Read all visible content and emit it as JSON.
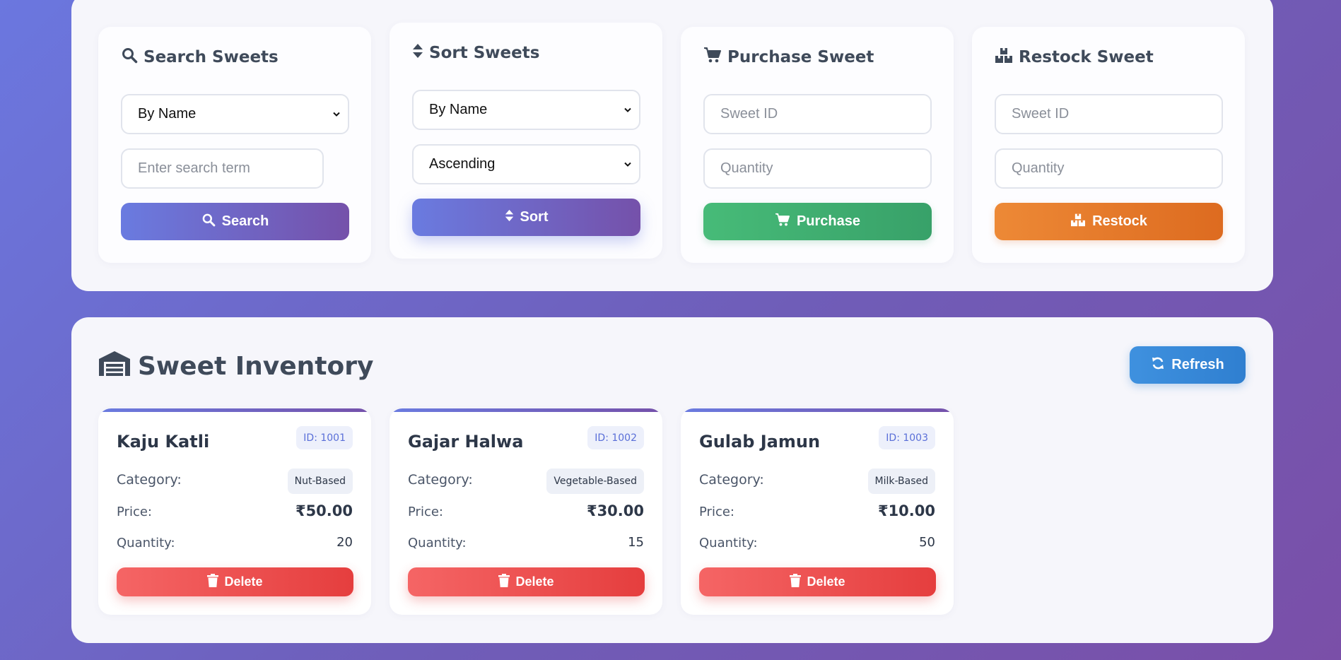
{
  "search": {
    "title": "Search Sweets",
    "by_select": "By Name",
    "input_placeholder": "Enter search term",
    "button": "Search",
    "icon": "search-icon"
  },
  "sort": {
    "title": "Sort Sweets",
    "by_select": "By Name",
    "order_select": "Ascending",
    "button": "Sort",
    "icon": "sort-icon"
  },
  "purchase": {
    "title": "Purchase Sweet",
    "id_placeholder": "Sweet ID",
    "qty_placeholder": "Quantity",
    "button": "Purchase",
    "icon": "cart-icon"
  },
  "restock": {
    "title": "Restock Sweet",
    "id_placeholder": "Sweet ID",
    "qty_placeholder": "Quantity",
    "button": "Restock",
    "icon": "boxes-icon"
  },
  "inventory": {
    "title": "Sweet Inventory",
    "refresh": "Refresh",
    "labels": {
      "category": "Category:",
      "price": "Price:",
      "quantity": "Quantity:"
    },
    "delete_label": "Delete",
    "items": [
      {
        "name": "Kaju Katli",
        "id": "ID: 1001",
        "category": "Nut-Based",
        "price": "₹50.00",
        "quantity": "20"
      },
      {
        "name": "Gajar Halwa",
        "id": "ID: 1002",
        "category": "Vegetable-Based",
        "price": "₹30.00",
        "quantity": "15"
      },
      {
        "name": "Gulab Jamun",
        "id": "ID: 1003",
        "category": "Milk-Based",
        "price": "₹10.00",
        "quantity": "50"
      }
    ]
  },
  "colors": {
    "primary_gradient_start": "#6a7be0",
    "primary_gradient_end": "#7551aa",
    "purchase_green": "#38a169",
    "restock_orange": "#dd6b20",
    "refresh_blue": "#3182ce",
    "delete_red": "#e53e3e"
  }
}
